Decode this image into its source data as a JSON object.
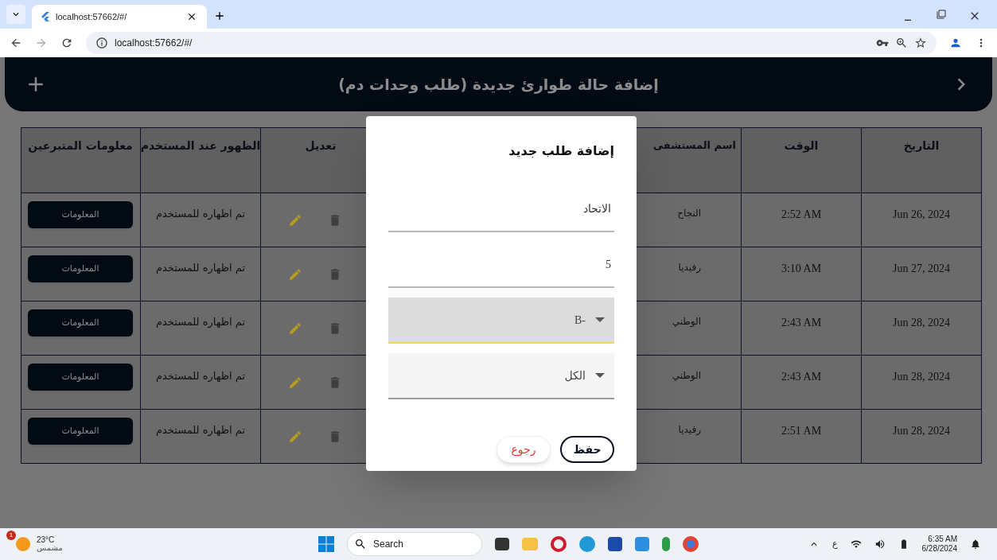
{
  "browser": {
    "tab_title": "localhost:57662/#/",
    "url": "localhost:57662/#/"
  },
  "header": {
    "title": "إضافة حالة طوارئ جديدة (طلب وحدات دم)"
  },
  "table": {
    "columns": [
      "التاريخ",
      "الوقت",
      "اسم المستشفى",
      "تعديل",
      "الظهور عند المستخدم",
      "معلومات المتبرعين"
    ],
    "rows": [
      {
        "date": "Jun 26, 2024",
        "time": "2:52 AM",
        "hospital": "النجاح",
        "visibility": "تم اظهاره للمستخدم",
        "info_button": "المعلومات"
      },
      {
        "date": "Jun 27, 2024",
        "time": "3:10 AM",
        "hospital": "رفيديا",
        "visibility": "تم اظهاره للمستخدم",
        "info_button": "المعلومات"
      },
      {
        "date": "Jun 28, 2024",
        "time": "2:43 AM",
        "hospital": "الوطني",
        "visibility": "تم اظهاره للمستخدم",
        "info_button": "المعلومات"
      },
      {
        "date": "Jun 28, 2024",
        "time": "2:43 AM",
        "hospital": "الوطني",
        "visibility": "تم اظهاره للمستخدم",
        "info_button": "المعلومات"
      },
      {
        "date": "Jun 28, 2024",
        "time": "2:51 AM",
        "hospital": "رفيديا",
        "visibility": "تم اظهاره للمستخدم",
        "info_button": "المعلومات"
      }
    ]
  },
  "dialog": {
    "title": "إضافة طلب جديد",
    "fields": [
      {
        "kind": "text",
        "value": "الاتحاد",
        "focused": false
      },
      {
        "kind": "text",
        "value": "5",
        "focused": false
      },
      {
        "kind": "dropdown",
        "value": "B-",
        "focused": true
      },
      {
        "kind": "dropdown",
        "value": "الكل",
        "focused": false
      }
    ],
    "buttons": [
      {
        "kind": "primary",
        "label": "حفظ"
      },
      {
        "kind": "cancel",
        "label": "رجوع"
      }
    ]
  },
  "taskbar": {
    "weather": {
      "badge": "1",
      "temperature": "23°C",
      "condition": "مشمس"
    },
    "search": "Search",
    "keyboard": "ع",
    "time": "6:35 AM",
    "date": "6/28/2024"
  }
}
